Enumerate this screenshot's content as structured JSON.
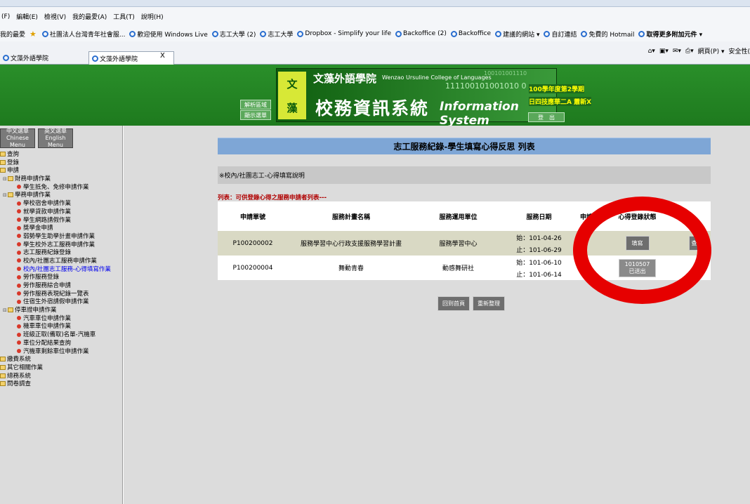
{
  "ie": {
    "menu": [
      "(F)",
      "編輯(E)",
      "檢視(V)",
      "我的最愛(A)",
      "工具(T)",
      "說明(H)"
    ],
    "favorites": {
      "label": "我的最愛",
      "items": [
        "社團法人台灣青年社會服...",
        "歡迎使用 Windows Live",
        "志工大學 (2)",
        "志工大學",
        "Dropbox - Simplify your life",
        "Backoffice (2)",
        "Backoffice",
        "建議的網站 ▾",
        "自訂連結",
        "免費的 Hotmail",
        "取得更多附加元件 ▾"
      ]
    },
    "tabs": [
      {
        "label": "文藻外語學院"
      },
      {
        "label": "文藻外語學院"
      }
    ],
    "tab_close": "X",
    "tools": [
      "網頁(P) ▾",
      "安全性("
    ]
  },
  "header": {
    "logo_chars": [
      "文",
      "藻"
    ],
    "college_cn": "文藻外語學院",
    "college_en": "Wenzao Ursuline College of Languages",
    "binary_top": "100101001110",
    "binary_bottom": "111100101001010 0",
    "system_cn": "校務資訊系統",
    "system_en": "Information System",
    "btn_adjust": "解析區域",
    "btn_show": "顯示選單",
    "semester": "100學年度第2學期",
    "class_name": "日四技應華二A 蕭新X",
    "logout": "登　出"
  },
  "sidebar": {
    "lang_cn": "中文選單 Chinese Menu",
    "lang_en": "英文選單 English Menu",
    "tree": [
      {
        "level": 0,
        "type": "folder",
        "label": "查詢"
      },
      {
        "level": 0,
        "type": "folder",
        "label": "登錄"
      },
      {
        "level": 0,
        "type": "folder",
        "label": "申請"
      },
      {
        "level": 1,
        "type": "folder",
        "label": "財務申請作業"
      },
      {
        "level": 2,
        "type": "leaf",
        "label": "學生抵免、免修申請作業"
      },
      {
        "level": 1,
        "type": "folder",
        "label": "學務申請作業"
      },
      {
        "level": 2,
        "type": "leaf",
        "label": "學校宿舍申請作業"
      },
      {
        "level": 2,
        "type": "leaf",
        "label": "就學貸款申請作業"
      },
      {
        "level": 2,
        "type": "leaf",
        "label": "學生網路請假作業"
      },
      {
        "level": 2,
        "type": "leaf",
        "label": "獎學金申請"
      },
      {
        "level": 2,
        "type": "leaf",
        "label": "弱勢學生助學計畫申請作業"
      },
      {
        "level": 2,
        "type": "leaf",
        "label": "學生校外志工服務申請作業"
      },
      {
        "level": 2,
        "type": "leaf",
        "label": "志工服務紀錄登錄"
      },
      {
        "level": 2,
        "type": "leaf",
        "label": "校內/社團志工服務申請作業"
      },
      {
        "level": 2,
        "type": "leaf",
        "label": "校內/社團志工服務-心得填寫作業",
        "active": true
      },
      {
        "level": 2,
        "type": "leaf",
        "label": "勞作服務登錄"
      },
      {
        "level": 2,
        "type": "leaf",
        "label": "勞作服務綜合申請"
      },
      {
        "level": 2,
        "type": "leaf",
        "label": "勞作服務表現紀錄一覽表"
      },
      {
        "level": 2,
        "type": "leaf",
        "label": "住宿生外宿請假申請作業"
      },
      {
        "level": 1,
        "type": "folder",
        "label": "停車證申請作業"
      },
      {
        "level": 2,
        "type": "leaf",
        "label": "汽車車位申請作業"
      },
      {
        "level": 2,
        "type": "leaf",
        "label": "機車車位申請作業"
      },
      {
        "level": 2,
        "type": "leaf",
        "label": "班級正取(備取)名單-汽機車"
      },
      {
        "level": 2,
        "type": "leaf",
        "label": "車位分配結果查詢"
      },
      {
        "level": 2,
        "type": "leaf",
        "label": "汽機車剩餘車位申請作業"
      },
      {
        "level": 0,
        "type": "folder",
        "label": "繳費系統"
      },
      {
        "level": 0,
        "type": "folder",
        "label": "其它相關作業"
      },
      {
        "level": 0,
        "type": "folder",
        "label": "總務系統"
      },
      {
        "level": 0,
        "type": "folder",
        "label": "問卷調查"
      }
    ]
  },
  "main": {
    "title": "志工服務紀錄-學生填寫心得反思 列表",
    "note": "※校內/社團志工-心得填寫說明",
    "list_label": "列表：可供登錄心得之服務申請者列表---",
    "columns": [
      "申請單號",
      "服務計畫名稱",
      "服務運用單位",
      "服務日期",
      "申請",
      "心得登錄狀態",
      ""
    ],
    "rows": [
      {
        "id": "P100200002",
        "plan": "服務學習中心行政支援服務學習計畫",
        "unit": "服務學習中心",
        "start": "始：101-04-26",
        "end": "止：101-06-29",
        "status_btn": "填寫",
        "extra_btn": "查"
      },
      {
        "id": "P100200004",
        "plan": "舞動青春",
        "unit": "動感舞研社",
        "start": "始：101-06-10",
        "end": "止：101-06-14",
        "status_date": "1010507",
        "status_text": "已送出"
      }
    ],
    "btn_home": "回到首頁",
    "btn_refresh": "重新整理"
  },
  "colors": {
    "annotation_circle": "#e60000",
    "header_green": "#2a8f2a",
    "title_blue": "#7ea6d6"
  }
}
